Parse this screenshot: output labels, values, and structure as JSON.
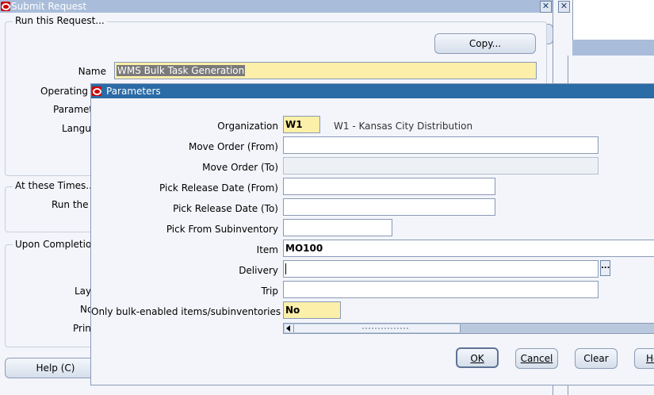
{
  "submit_window": {
    "title": "Submit Request",
    "run_group_label": "Run this Request...",
    "copy_button": "Copy...",
    "name_label": "Name",
    "name_value": "WMS Bulk Task Generation",
    "operating_label": "Operating U",
    "parameters_label": "Paramete",
    "language_label": "Langu",
    "times_group_label": "At these Times...",
    "run_the_label": "Run the",
    "completion_group_label": "Upon Completion",
    "layout_label": "Lay",
    "notify_label": "No",
    "print_label": "Prin",
    "help_button": "Help (C)"
  },
  "params_window": {
    "title": "Parameters",
    "organization_label": "Organization",
    "organization_code": "W1",
    "organization_desc": "W1 - Kansas City Distribution",
    "move_order_from_label": "Move Order (From)",
    "move_order_from_value": "",
    "move_order_to_label": "Move Order (To)",
    "move_order_to_value": "",
    "pick_release_from_label": "Pick Release Date (From)",
    "pick_release_from_value": "",
    "pick_release_to_label": "Pick Release Date (To)",
    "pick_release_to_value": "",
    "pick_subinventory_label": "Pick From Subinventory",
    "pick_subinventory_value": "",
    "item_label": "Item",
    "item_value": "MO100",
    "delivery_label": "Delivery",
    "delivery_value": "",
    "lov_button": "...",
    "trip_label": "Trip",
    "trip_value": "",
    "bulk_label": "Only bulk-enabled items/subinventories",
    "bulk_value": "No",
    "ok_button": "OK",
    "cancel_button": "Cancel",
    "clear_button": "Clear",
    "help_button": "He"
  },
  "colors": {
    "title_active": "#2b6ba6",
    "title_inactive": "#a9bdda",
    "required_field": "#fcefa9",
    "window_bg": "#f3f5fa"
  }
}
